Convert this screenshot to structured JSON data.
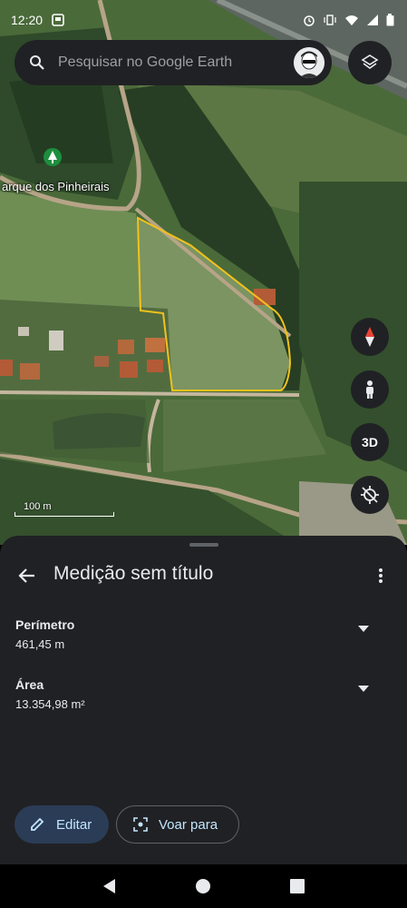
{
  "status_bar": {
    "time": "12:20",
    "icons": [
      "notification-icon",
      "alarm-icon",
      "vibrate-icon",
      "wifi-icon",
      "signal-icon",
      "battery-icon"
    ]
  },
  "search": {
    "placeholder": "Pesquisar no Google Earth",
    "icon": "search-icon"
  },
  "map": {
    "place_label": "arque dos Pinheirais",
    "scale_label": "100 m",
    "controls": {
      "compass": "compass-icon",
      "street_view": "pegman-icon",
      "view_3d_label": "3D",
      "recenter": "location-off-icon"
    },
    "polygon_color": "#f2c21b"
  },
  "sheet": {
    "title": "Medição sem título",
    "metrics": [
      {
        "label": "Perímetro",
        "value": "461,45 m"
      },
      {
        "label": "Área",
        "value": "13.354,98 m²"
      }
    ],
    "buttons": {
      "edit_label": "Editar",
      "fly_label": "Voar para"
    },
    "accent_color": "#c2e7ff"
  },
  "nav": {
    "icons": [
      "back-nav-icon",
      "home-nav-icon",
      "recents-nav-icon"
    ]
  }
}
